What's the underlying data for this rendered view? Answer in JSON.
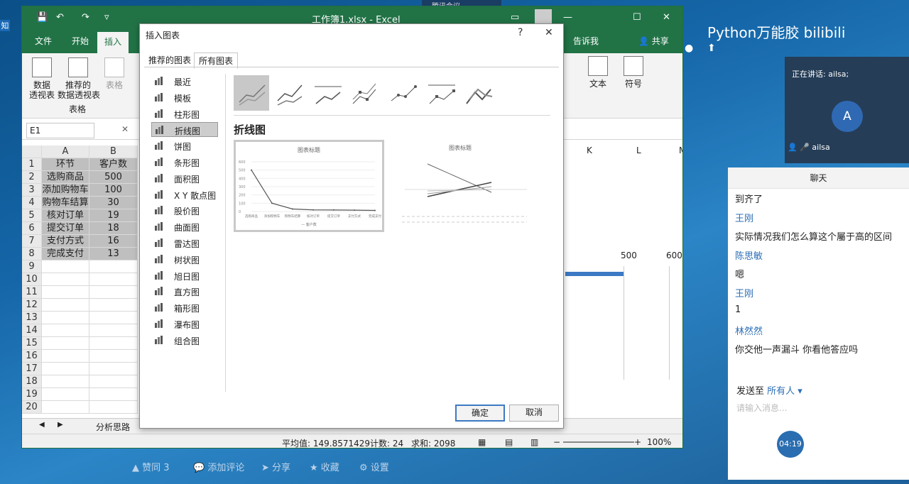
{
  "excel": {
    "window_title": "工作簿1.xlsx - Excel",
    "tabs": [
      "文件",
      "开始",
      "插入"
    ],
    "tell_me": "告诉我",
    "share": "共享",
    "ribbon": {
      "pivot_table": "数据\n透视表",
      "recommended_pivot": "推荐的\n数据透视表",
      "table": "表格",
      "group_tables": "表格",
      "text": "文本",
      "symbol": "符号"
    },
    "name_box": "E1",
    "columns": [
      "A",
      "B"
    ],
    "bg_columns": [
      "K",
      "L",
      "M"
    ],
    "rows": [
      {
        "n": "1",
        "a": "环节",
        "b": "客户数"
      },
      {
        "n": "2",
        "a": "选购商品",
        "b": "500"
      },
      {
        "n": "3",
        "a": "添加购物车",
        "b": "100"
      },
      {
        "n": "4",
        "a": "购物车结算",
        "b": "30"
      },
      {
        "n": "5",
        "a": "核对订单",
        "b": "19"
      },
      {
        "n": "6",
        "a": "提交订单",
        "b": "18"
      },
      {
        "n": "7",
        "a": "支付方式",
        "b": "16"
      },
      {
        "n": "8",
        "a": "完成支付",
        "b": "13"
      },
      {
        "n": "9",
        "a": "",
        "b": ""
      },
      {
        "n": "10",
        "a": "",
        "b": ""
      },
      {
        "n": "11",
        "a": "",
        "b": ""
      },
      {
        "n": "12",
        "a": "",
        "b": ""
      },
      {
        "n": "13",
        "a": "",
        "b": ""
      },
      {
        "n": "14",
        "a": "",
        "b": ""
      },
      {
        "n": "15",
        "a": "",
        "b": ""
      },
      {
        "n": "16",
        "a": "",
        "b": ""
      },
      {
        "n": "17",
        "a": "",
        "b": ""
      },
      {
        "n": "18",
        "a": "",
        "b": ""
      },
      {
        "n": "19",
        "a": "",
        "b": ""
      },
      {
        "n": "20",
        "a": "",
        "b": ""
      }
    ],
    "bg_axis_labels": [
      "500",
      "600"
    ],
    "sheet_tab": "分析思路",
    "status": {
      "average": "平均值: 149.8571429",
      "count": "计数: 24",
      "sum": "求和: 2098",
      "zoom": "100%"
    }
  },
  "dialog": {
    "title": "插入图表",
    "help": "?",
    "close": "✕",
    "tabs": [
      "推荐的图表",
      "所有图表"
    ],
    "categories": [
      "最近",
      "模板",
      "柱形图",
      "折线图",
      "饼图",
      "条形图",
      "面积图",
      "X Y 散点图",
      "股价图",
      "曲面图",
      "雷达图",
      "树状图",
      "旭日图",
      "直方图",
      "箱形图",
      "瀑布图",
      "组合图"
    ],
    "selected_category": "折线图",
    "chart_type_title": "折线图",
    "preview_title": "图表标题",
    "ok": "确定",
    "cancel": "取消"
  },
  "meeting": {
    "top_app": "腾讯会议",
    "banner": "Python万能胶 bilibili",
    "speaking": "正在讲话: ailsa;",
    "avatar_letter": "A",
    "speaker_name": "ailsa",
    "chat_header": "聊天",
    "messages": [
      {
        "type": "text",
        "text": "到齐了"
      },
      {
        "type": "name",
        "text": "王刚"
      },
      {
        "type": "text",
        "text": "实际情况我们怎么算这个屬于高的区间"
      },
      {
        "type": "name",
        "text": "陈思敏"
      },
      {
        "type": "text",
        "text": "嗯"
      },
      {
        "type": "name",
        "text": "王刚"
      },
      {
        "type": "text",
        "text": "1"
      },
      {
        "type": "name",
        "text": "林然然"
      },
      {
        "type": "text",
        "text": "你交他一声漏斗 你看他答应吗"
      }
    ],
    "send_to_label": "发送至",
    "send_to_value": "所有人",
    "input_placeholder": "请输入消息...",
    "timer": "04:19"
  },
  "bottom_bar": {
    "like": "赞同 3",
    "comment": "添加评论",
    "share": "分享",
    "favorite": "收藏",
    "settings": "设置"
  },
  "chart_data": {
    "type": "line",
    "categories": [
      "选购商品",
      "添加购物车",
      "购物车结算",
      "核对订单",
      "提交订单",
      "支付方式",
      "完成支付"
    ],
    "series": [
      {
        "name": "客户数",
        "values": [
          500,
          100,
          30,
          19,
          18,
          16,
          13
        ]
      }
    ],
    "title": "图表标题",
    "ylim": [
      0,
      600
    ]
  }
}
